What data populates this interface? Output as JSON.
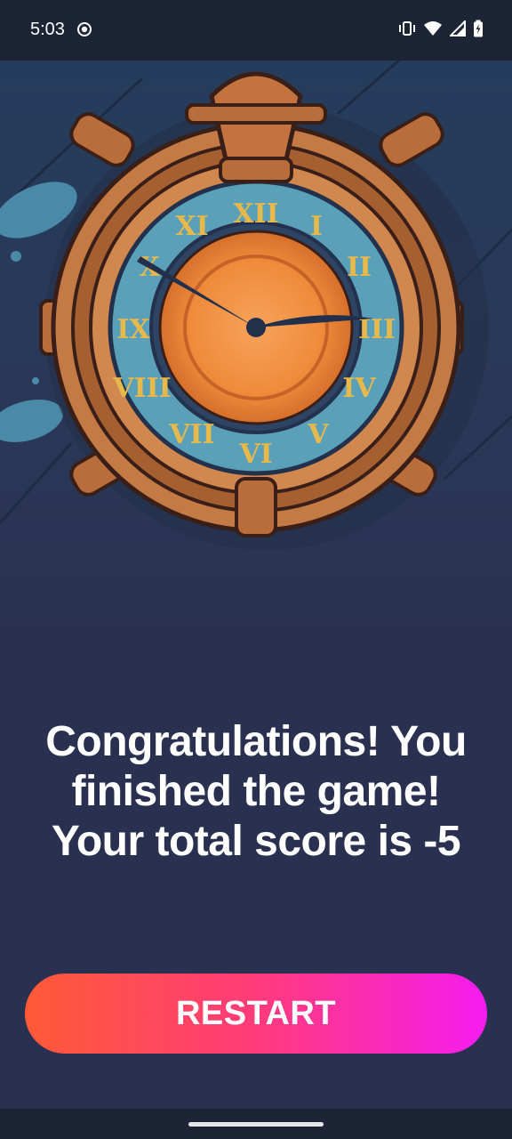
{
  "status_bar": {
    "time": "5:03",
    "left_icon": "location-dot-icon",
    "right_icons": [
      "vibrate-icon",
      "wifi-icon",
      "signal-icon",
      "battery-charging-icon"
    ]
  },
  "hero": {
    "image": "ornate-clock-illustration"
  },
  "message": {
    "text": "Congratulations! You finished the game! Your total score is -5"
  },
  "actions": {
    "restart_label": "RESTART"
  },
  "colors": {
    "background": "#2a3150",
    "status_bar": "#1c2436",
    "button_gradient_start": "#ff5a36",
    "button_gradient_end": "#f51cf0",
    "text": "#ffffff"
  }
}
